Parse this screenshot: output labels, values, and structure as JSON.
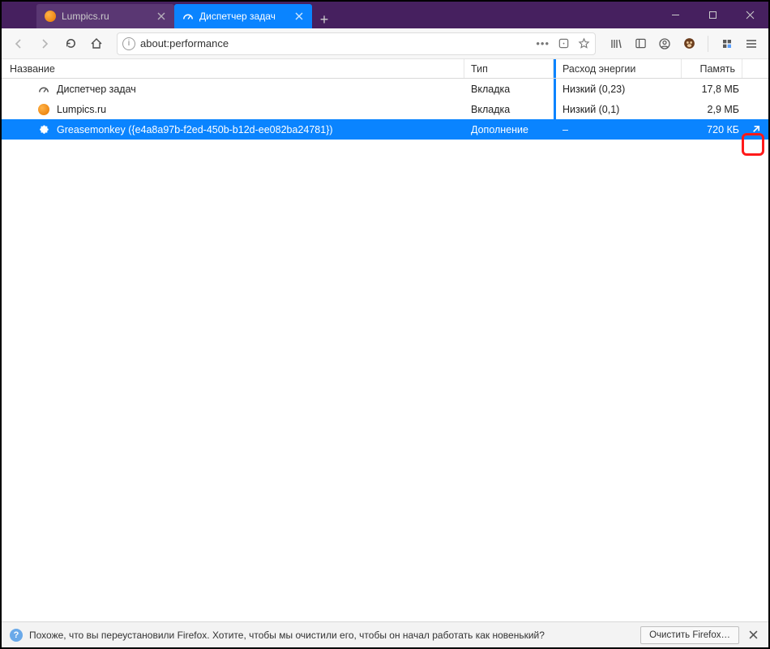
{
  "tabs": [
    {
      "title": "Lumpics.ru",
      "active": false
    },
    {
      "title": "Диспетчер задач",
      "active": true
    }
  ],
  "urlbar": {
    "value": "about:performance"
  },
  "columns": {
    "name": "Название",
    "type": "Тип",
    "energy": "Расход энергии",
    "memory": "Память"
  },
  "rows": [
    {
      "icon": "gauge",
      "name": "Диспетчер задач",
      "type": "Вкладка",
      "energy": "Низкий (0,23)",
      "memory": "17,8 МБ",
      "selected": false
    },
    {
      "icon": "orange",
      "name": "Lumpics.ru",
      "type": "Вкладка",
      "energy": "Низкий (0,1)",
      "memory": "2,9 МБ",
      "selected": false
    },
    {
      "icon": "puzzle",
      "name": "Greasemonkey ({e4a8a97b-f2ed-450b-b12d-ee082ba24781})",
      "type": "Дополнение",
      "energy": "–",
      "memory": "720 КБ",
      "selected": true
    }
  ],
  "infobar": {
    "text": "Похоже, что вы переустановили Firefox. Хотите, чтобы мы очистили его, чтобы он начал работать как новенький?",
    "button": "Очистить Firefox…"
  }
}
